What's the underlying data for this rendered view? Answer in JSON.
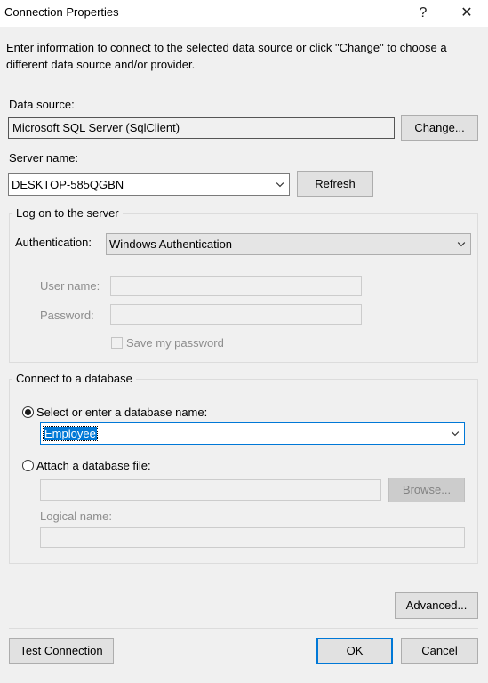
{
  "window": {
    "title": "Connection Properties",
    "help_glyph": "?",
    "close_glyph": "✕"
  },
  "intro_text": "Enter information to connect to the selected data source or click \"Change\" to choose a different data source and/or provider.",
  "data_source": {
    "label": "Data source:",
    "value": "Microsoft SQL Server (SqlClient)",
    "change_button": "Change..."
  },
  "server": {
    "label": "Server name:",
    "value": "DESKTOP-585QGBN",
    "refresh_button": "Refresh"
  },
  "logon": {
    "legend": "Log on to the server",
    "auth_label": "Authentication:",
    "auth_value": "Windows Authentication",
    "username_label": "User name:",
    "password_label": "Password:",
    "save_password_label": "Save my password"
  },
  "database": {
    "legend": "Connect to a database",
    "select_radio_label": "Select or enter a database name:",
    "db_name_value": "Employee",
    "attach_radio_label": "Attach a database file:",
    "browse_button": "Browse...",
    "logical_name_label": "Logical name:"
  },
  "buttons": {
    "advanced": "Advanced...",
    "test_connection": "Test Connection",
    "ok": "OK",
    "cancel": "Cancel"
  }
}
